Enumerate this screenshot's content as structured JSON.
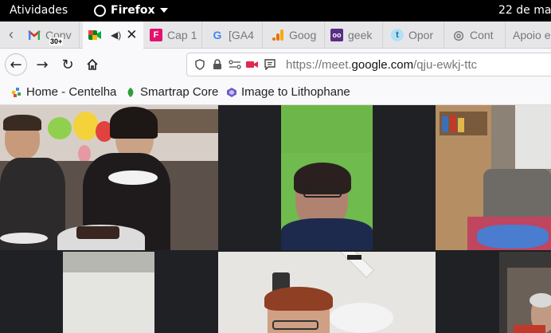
{
  "system_bar": {
    "activities": "Atividades",
    "app_name": "Firefox",
    "clock": "22 de mar"
  },
  "tabs": [
    {
      "label": "Conv",
      "icon": "gmail-icon",
      "badge": "30+",
      "active": false
    },
    {
      "label": "",
      "icon": "google-meet-icon",
      "active": true,
      "audio": true
    },
    {
      "label": "Cap 1",
      "icon": "form-icon",
      "active": false
    },
    {
      "label": "[GA4",
      "icon": "google-icon",
      "active": false
    },
    {
      "label": "Goog",
      "icon": "analytics-icon",
      "active": false
    },
    {
      "label": "geek",
      "icon": "geek-icon",
      "active": false
    },
    {
      "label": "Opor",
      "icon": "t-icon",
      "active": false
    },
    {
      "label": "Cont",
      "icon": "globe-icon",
      "active": false
    },
    {
      "label": "Apoio e",
      "icon": "",
      "active": false
    }
  ],
  "navigation": {
    "url_prefix": "https://meet.",
    "url_domain": "google.com",
    "url_path": "/qju-ewkj-ttc"
  },
  "bookmarks": [
    {
      "label": "Home - Centelha",
      "icon": "centelha-icon"
    },
    {
      "label": "Smartrap Core",
      "icon": "leaf-icon"
    },
    {
      "label": "Image to Lithophane",
      "icon": "lithophane-icon"
    }
  ],
  "colors": {
    "topbar": "#000000",
    "tabbar": "#e6e6e9",
    "toolbar": "#f9f9fb",
    "meet_background": "#202124"
  }
}
